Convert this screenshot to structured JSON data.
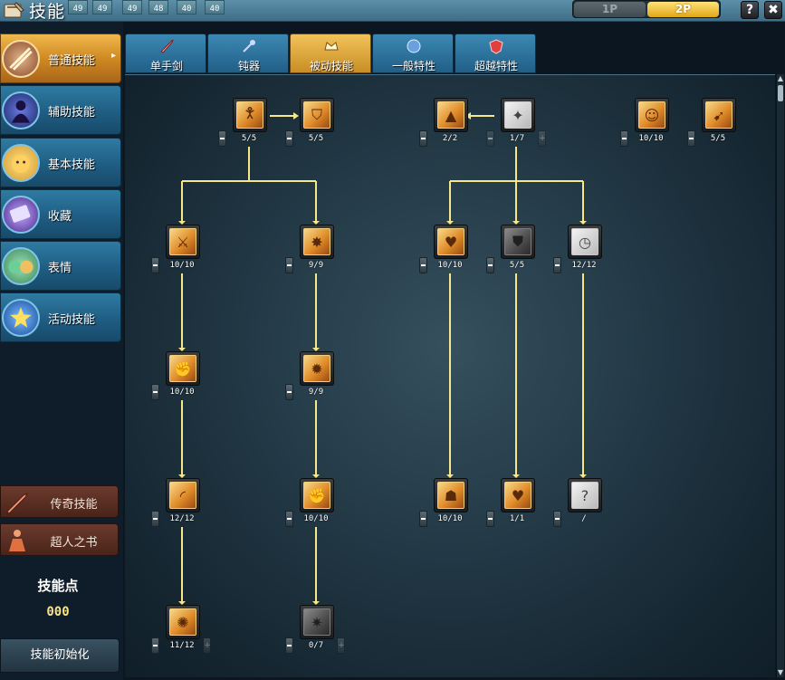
{
  "window": {
    "title": "技能"
  },
  "party_strip": [
    "49",
    "49",
    "49",
    "48",
    "40",
    "40"
  ],
  "player_toggle": {
    "p1": "1P",
    "p2": "2P",
    "active": "2P"
  },
  "top_buttons": {
    "help": "?",
    "close": "✖"
  },
  "sidebar": {
    "categories": [
      {
        "label": "普通技能",
        "active": true,
        "icon": "sword-slash-icon"
      },
      {
        "label": "辅助技能",
        "active": false,
        "icon": "shadow-figure-icon"
      },
      {
        "label": "基本技能",
        "active": false,
        "icon": "cat-face-icon"
      },
      {
        "label": "收藏",
        "active": false,
        "icon": "card-collection-icon"
      },
      {
        "label": "表情",
        "active": false,
        "icon": "cat-emote-icon"
      },
      {
        "label": "活动技能",
        "active": false,
        "icon": "star-icon"
      }
    ],
    "legend_skill": "传奇技能",
    "superhuman_book": "超人之书",
    "skill_points_label": "技能点",
    "skill_points_value": "000",
    "reset_label": "技能初始化"
  },
  "tabs": [
    {
      "label": "单手剑",
      "icon": "sword-icon",
      "active": false
    },
    {
      "label": "钝器",
      "icon": "mace-icon",
      "active": false
    },
    {
      "label": "被动技能",
      "icon": "passive-crown-icon",
      "active": true
    },
    {
      "label": "一般特性",
      "icon": "orb-icon",
      "active": false
    },
    {
      "label": "超越特性",
      "icon": "shield-badge-icon",
      "active": false
    }
  ],
  "skills": [
    {
      "id": "s1",
      "level": "5/5",
      "icon": "stance-figure-icon",
      "style": "gold",
      "plus": false
    },
    {
      "id": "s2",
      "level": "5/5",
      "icon": "shield-up-icon",
      "style": "gold",
      "plus": false
    },
    {
      "id": "s3",
      "level": "2/2",
      "icon": "max-up-icon",
      "style": "gold",
      "plus": false
    },
    {
      "id": "s4",
      "level": "1/7",
      "icon": "aura-figure-icon",
      "style": "blank",
      "plus": true,
      "plus_faded": true,
      "minus_faded": true
    },
    {
      "id": "s5",
      "level": "10/10",
      "icon": "face-buff-icon",
      "style": "gold",
      "plus": false
    },
    {
      "id": "s6",
      "level": "5/5",
      "icon": "dash-figure-icon",
      "style": "gold",
      "plus": false
    },
    {
      "id": "s7",
      "level": "10/10",
      "icon": "crossed-swords-icon",
      "style": "gold",
      "plus": false
    },
    {
      "id": "s8",
      "level": "9/9",
      "icon": "burst-figure-icon",
      "style": "gold",
      "plus": false
    },
    {
      "id": "s9",
      "level": "10/10",
      "icon": "heart-hp-icon",
      "style": "gold",
      "plus": false
    },
    {
      "id": "s10",
      "level": "5/5",
      "icon": "dark-shield-icon",
      "style": "dim",
      "plus": false
    },
    {
      "id": "s11",
      "level": "12/12",
      "icon": "clock-speed-icon",
      "style": "blank",
      "plus": false
    },
    {
      "id": "s12",
      "level": "10/10",
      "icon": "muscle-arm-icon",
      "style": "gold",
      "plus": false
    },
    {
      "id": "s13",
      "level": "9/9",
      "icon": "flame-fist-icon",
      "style": "gold",
      "plus": false
    },
    {
      "id": "s14",
      "level": "12/12",
      "icon": "slash-arc-icon",
      "style": "gold",
      "plus": false
    },
    {
      "id": "s15",
      "level": "10/10",
      "icon": "power-fist-icon",
      "style": "gold",
      "plus": false
    },
    {
      "id": "s16",
      "level": "10/10",
      "icon": "meditate-figure-icon",
      "style": "gold",
      "plus": false
    },
    {
      "id": "s17",
      "level": "1/1",
      "icon": "small-heart-icon",
      "style": "gold",
      "plus": false
    },
    {
      "id": "s18",
      "level": "/",
      "icon": "mystery-icon",
      "style": "blank",
      "plus": false
    },
    {
      "id": "s19",
      "level": "11/12",
      "icon": "strike-fist-icon",
      "style": "gold",
      "plus": true,
      "plus_faded": true
    },
    {
      "id": "s20",
      "level": "0/7",
      "icon": "crit-icon",
      "style": "dim",
      "plus": true,
      "plus_faded": true
    }
  ],
  "colors": {
    "accent_gold": "#f1c35a",
    "tab_blue": "#2f7ba3",
    "connector": "#f6e88a",
    "level_text": "#ffffff",
    "skill_points": "#f6e48c"
  }
}
